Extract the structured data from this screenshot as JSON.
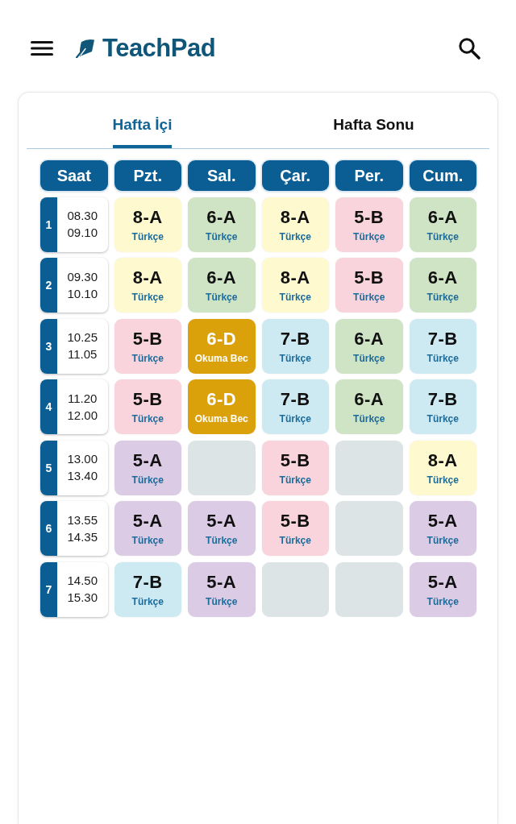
{
  "header": {
    "title": "TeachPad"
  },
  "tabs": [
    {
      "label": "Hafta İçi",
      "selected": true
    },
    {
      "label": "Hafta Sonu",
      "selected": false
    }
  ],
  "timetable": {
    "columns": [
      "Saat",
      "Pzt.",
      "Sal.",
      "Çar.",
      "Per.",
      "Cum."
    ],
    "rows": [
      {
        "cells": [
          {
            "kind": "time",
            "period": "1",
            "start": "08.30",
            "end": "09.10"
          },
          {
            "kind": "lesson",
            "class": "8-A",
            "subject": "Türkçe",
            "color": "#fef9cf"
          },
          {
            "kind": "lesson",
            "class": "6-A",
            "subject": "Türkçe",
            "color": "#cfe3c5"
          },
          {
            "kind": "lesson",
            "class": "8-A",
            "subject": "Türkçe",
            "color": "#fef9cf"
          },
          {
            "kind": "lesson",
            "class": "5-B",
            "subject": "Türkçe",
            "color": "#f9d4dc"
          },
          {
            "kind": "lesson",
            "class": "6-A",
            "subject": "Türkçe",
            "color": "#cfe3c5"
          }
        ]
      },
      {
        "cells": [
          {
            "kind": "time",
            "period": "2",
            "start": "09.30",
            "end": "10.10"
          },
          {
            "kind": "lesson",
            "class": "8-A",
            "subject": "Türkçe",
            "color": "#fef9cf"
          },
          {
            "kind": "lesson",
            "class": "6-A",
            "subject": "Türkçe",
            "color": "#cfe3c5"
          },
          {
            "kind": "lesson",
            "class": "8-A",
            "subject": "Türkçe",
            "color": "#fef9cf"
          },
          {
            "kind": "lesson",
            "class": "5-B",
            "subject": "Türkçe",
            "color": "#f9d4dc"
          },
          {
            "kind": "lesson",
            "class": "6-A",
            "subject": "Türkçe",
            "color": "#cfe3c5"
          }
        ]
      },
      {
        "cells": [
          {
            "kind": "time",
            "period": "3",
            "start": "10.25",
            "end": "11.05"
          },
          {
            "kind": "lesson",
            "class": "5-B",
            "subject": "Türkçe",
            "color": "#f9d4dc"
          },
          {
            "kind": "lesson",
            "class": "6-D",
            "subject": "Okuma Bec",
            "color": "#dba10b"
          },
          {
            "kind": "lesson",
            "class": "7-B",
            "subject": "Türkçe",
            "color": "#cdeaf3"
          },
          {
            "kind": "lesson",
            "class": "6-A",
            "subject": "Türkçe",
            "color": "#cfe3c5"
          },
          {
            "kind": "lesson",
            "class": "7-B",
            "subject": "Türkçe",
            "color": "#cdeaf3"
          }
        ]
      },
      {
        "cells": [
          {
            "kind": "time",
            "period": "4",
            "start": "11.20",
            "end": "12.00"
          },
          {
            "kind": "lesson",
            "class": "5-B",
            "subject": "Türkçe",
            "color": "#f9d4dc"
          },
          {
            "kind": "lesson",
            "class": "6-D",
            "subject": "Okuma Bec",
            "color": "#dba10b"
          },
          {
            "kind": "lesson",
            "class": "7-B",
            "subject": "Türkçe",
            "color": "#cdeaf3"
          },
          {
            "kind": "lesson",
            "class": "6-A",
            "subject": "Türkçe",
            "color": "#cfe3c5"
          },
          {
            "kind": "lesson",
            "class": "7-B",
            "subject": "Türkçe",
            "color": "#cdeaf3"
          }
        ]
      },
      {
        "cells": [
          {
            "kind": "time",
            "period": "5",
            "start": "13.00",
            "end": "13.40"
          },
          {
            "kind": "lesson",
            "class": "5-A",
            "subject": "Türkçe",
            "color": "#dbcbe5"
          },
          {
            "kind": "empty"
          },
          {
            "kind": "lesson",
            "class": "5-B",
            "subject": "Türkçe",
            "color": "#f9d4dc"
          },
          {
            "kind": "empty"
          },
          {
            "kind": "lesson",
            "class": "8-A",
            "subject": "Türkçe",
            "color": "#fef9cf"
          }
        ]
      },
      {
        "cells": [
          {
            "kind": "time",
            "period": "6",
            "start": "13.55",
            "end": "14.35"
          },
          {
            "kind": "lesson",
            "class": "5-A",
            "subject": "Türkçe",
            "color": "#dbcbe5"
          },
          {
            "kind": "lesson",
            "class": "5-A",
            "subject": "Türkçe",
            "color": "#dbcbe5"
          },
          {
            "kind": "lesson",
            "class": "5-B",
            "subject": "Türkçe",
            "color": "#f9d4dc"
          },
          {
            "kind": "empty"
          },
          {
            "kind": "lesson",
            "class": "5-A",
            "subject": "Türkçe",
            "color": "#dbcbe5"
          }
        ]
      },
      {
        "cells": [
          {
            "kind": "time",
            "period": "7",
            "start": "14.50",
            "end": "15.30"
          },
          {
            "kind": "lesson",
            "class": "7-B",
            "subject": "Türkçe",
            "color": "#cdeaf3"
          },
          {
            "kind": "lesson",
            "class": "5-A",
            "subject": "Türkçe",
            "color": "#dbcbe5"
          },
          {
            "kind": "empty"
          },
          {
            "kind": "empty"
          },
          {
            "kind": "lesson",
            "class": "5-A",
            "subject": "Türkçe",
            "color": "#dbcbe5"
          }
        ]
      }
    ]
  }
}
